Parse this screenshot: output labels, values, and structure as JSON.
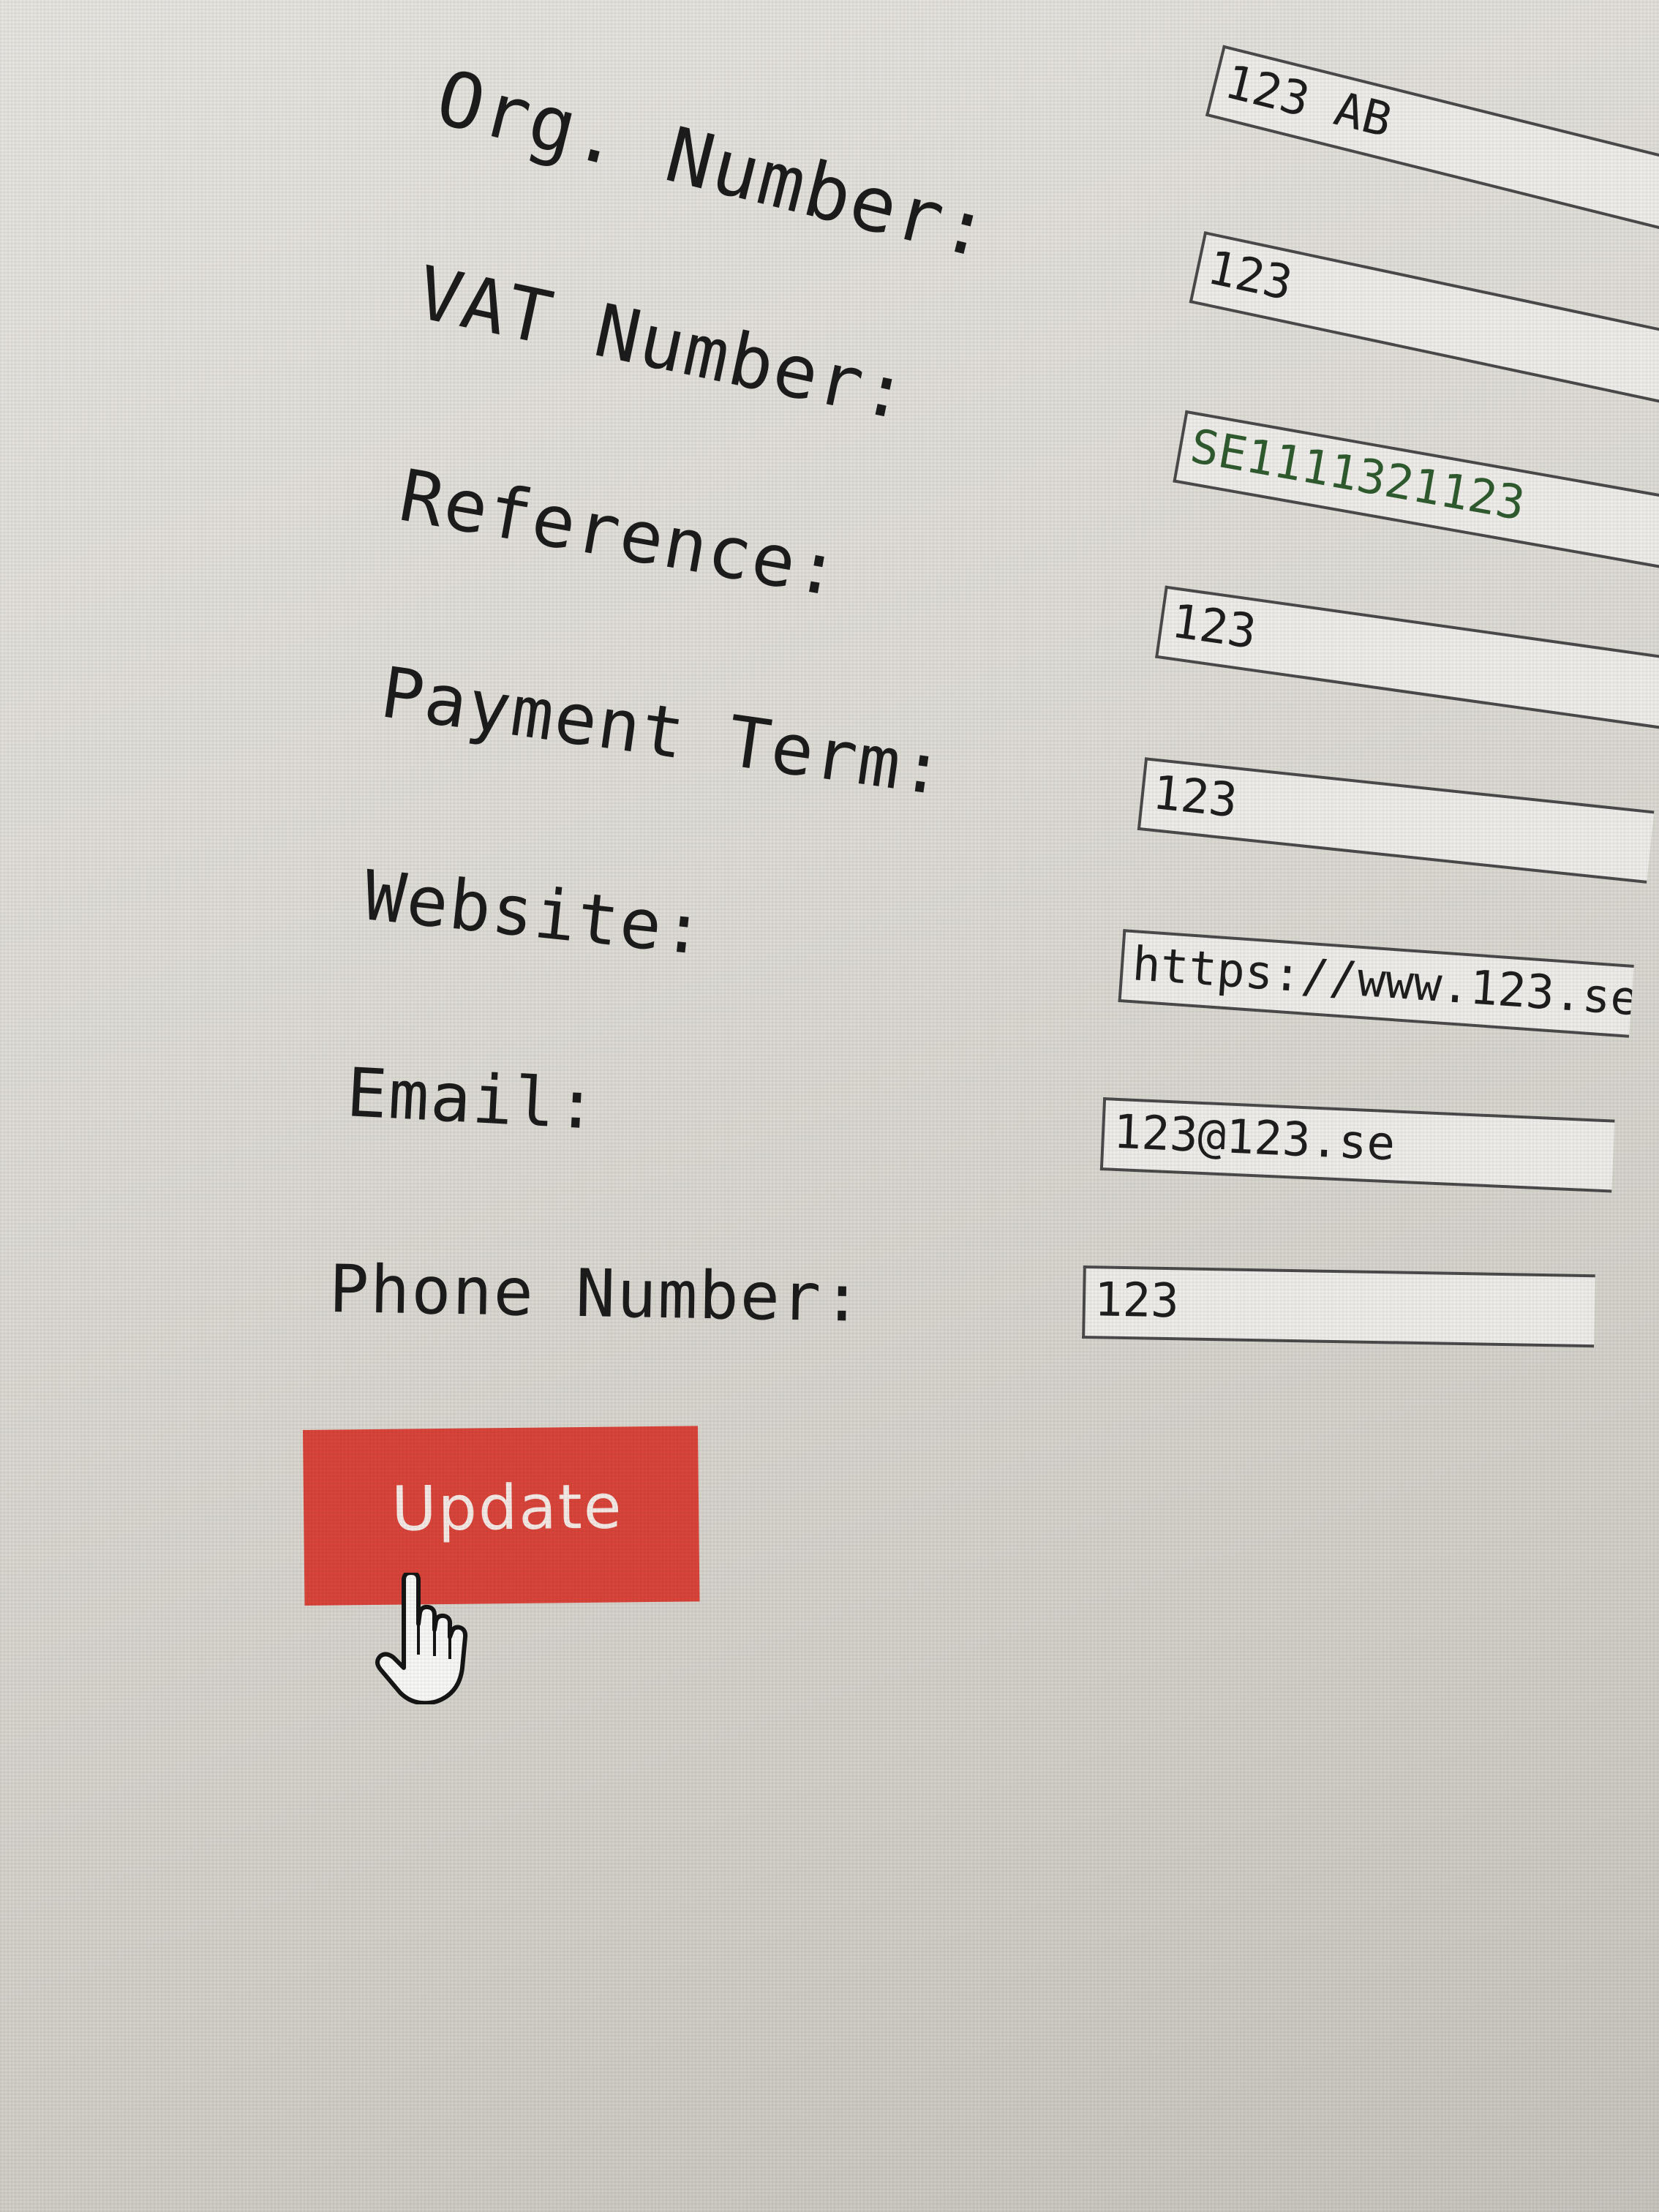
{
  "form": {
    "fields": [
      {
        "label": "Org. Number:",
        "value": "123 AB"
      },
      {
        "label": "VAT Number:",
        "value": "123"
      },
      {
        "label": "Reference:",
        "value": "SE1111321123"
      },
      {
        "label": "Payment Term:",
        "value": "123"
      },
      {
        "label": "Website:",
        "value": "123"
      },
      {
        "label": "Email:",
        "value": "https://www.123.se"
      },
      {
        "label": "Phone Number:",
        "value": "123@123.se"
      },
      {
        "label": "",
        "value": "123"
      }
    ],
    "update_label": "Update"
  },
  "colors": {
    "button": "#d9443a",
    "background": "#e3e1dc"
  },
  "icons": {
    "cursor": "hand-pointer-icon"
  }
}
